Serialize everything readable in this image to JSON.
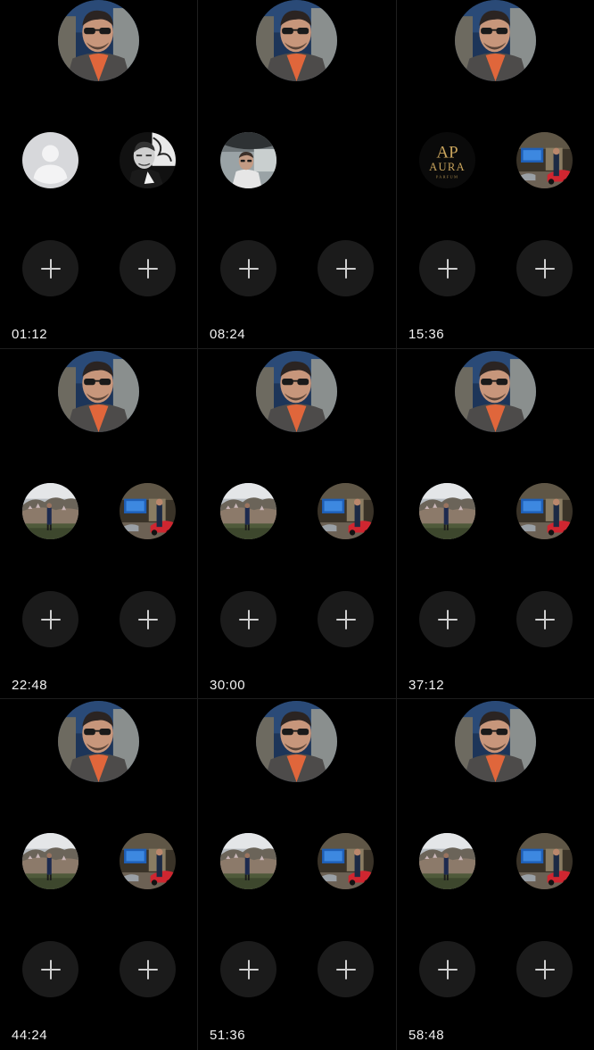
{
  "app": {
    "screen": "story-viewer-grid"
  },
  "cells": [
    {
      "timestamp": "01:12",
      "left_slot": "default-avatar",
      "right_slot": "profile-photo-man-bw"
    },
    {
      "timestamp": "08:24",
      "left_slot": "profile-photo-car",
      "right_slot": "none"
    },
    {
      "timestamp": "15:36",
      "left_slot": "aura-logo",
      "right_slot": "profile-photo-showroom"
    },
    {
      "timestamp": "22:48",
      "left_slot": "profile-photo-landscape",
      "right_slot": "profile-photo-showroom"
    },
    {
      "timestamp": "30:00",
      "left_slot": "profile-photo-landscape",
      "right_slot": "profile-photo-showroom"
    },
    {
      "timestamp": "37:12",
      "left_slot": "profile-photo-landscape",
      "right_slot": "profile-photo-showroom"
    },
    {
      "timestamp": "44:24",
      "left_slot": "profile-photo-landscape",
      "right_slot": "profile-photo-showroom"
    },
    {
      "timestamp": "51:36",
      "left_slot": "profile-photo-landscape",
      "right_slot": "profile-photo-showroom"
    },
    {
      "timestamp": "58:48",
      "left_slot": "profile-photo-landscape",
      "right_slot": "profile-photo-showroom"
    }
  ],
  "aura_logo": {
    "monogram": "AP",
    "name": "AURA",
    "sub": "PARFUM"
  },
  "colors": {
    "background": "#000000",
    "divider": "#1e1e1e",
    "add_button": "#1b1b1b",
    "plus": "#cfcfcf"
  }
}
